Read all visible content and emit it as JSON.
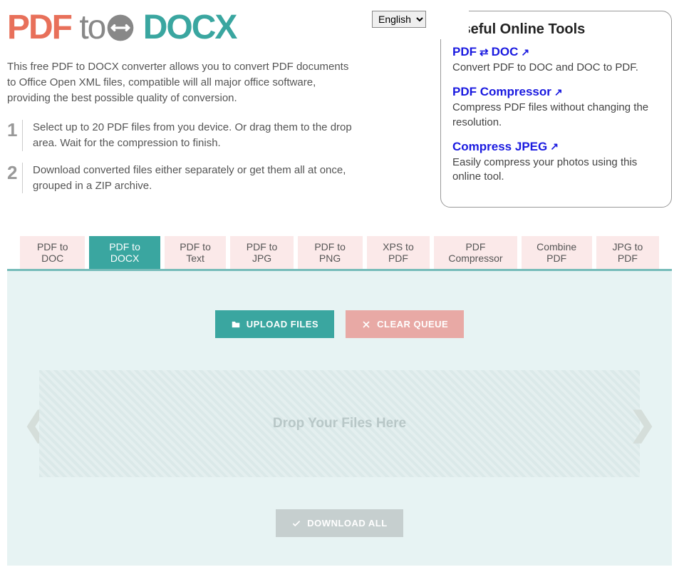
{
  "logo": {
    "pdf": "PDF",
    "to": "to",
    "docx": "DOCX"
  },
  "language": {
    "selected": "English"
  },
  "intro": "This free PDF to DOCX converter allows you to convert PDF documents to Office Open XML files, compatible will all major office software, providing the best possible quality of conversion.",
  "steps": [
    "Select up to 20 PDF files from you device. Or drag them to the drop area. Wait for the compression to finish.",
    "Download converted files either separately or get them all at once, grouped in a ZIP archive."
  ],
  "sidebar": {
    "title": "Useful Online Tools",
    "tools": [
      {
        "name": "PDF ⇄ DOC",
        "desc": "Convert PDF to DOC and DOC to PDF.",
        "swap": true
      },
      {
        "name": "PDF Compressor",
        "desc": "Compress PDF files without changing the resolution."
      },
      {
        "name": "Compress JPEG",
        "desc": "Easily compress your photos using this online tool."
      }
    ]
  },
  "tabs": [
    {
      "label": "PDF to DOC",
      "active": false
    },
    {
      "label": "PDF to DOCX",
      "active": true
    },
    {
      "label": "PDF to Text",
      "active": false
    },
    {
      "label": "PDF to JPG",
      "active": false
    },
    {
      "label": "PDF to PNG",
      "active": false
    },
    {
      "label": "XPS to PDF",
      "active": false
    },
    {
      "label": "PDF Compressor",
      "active": false
    },
    {
      "label": "Combine PDF",
      "active": false
    },
    {
      "label": "JPG to PDF",
      "active": false
    }
  ],
  "buttons": {
    "upload": "UPLOAD FILES",
    "clear": "CLEAR QUEUE",
    "download": "DOWNLOAD ALL"
  },
  "dropzone": "Drop Your Files Here"
}
